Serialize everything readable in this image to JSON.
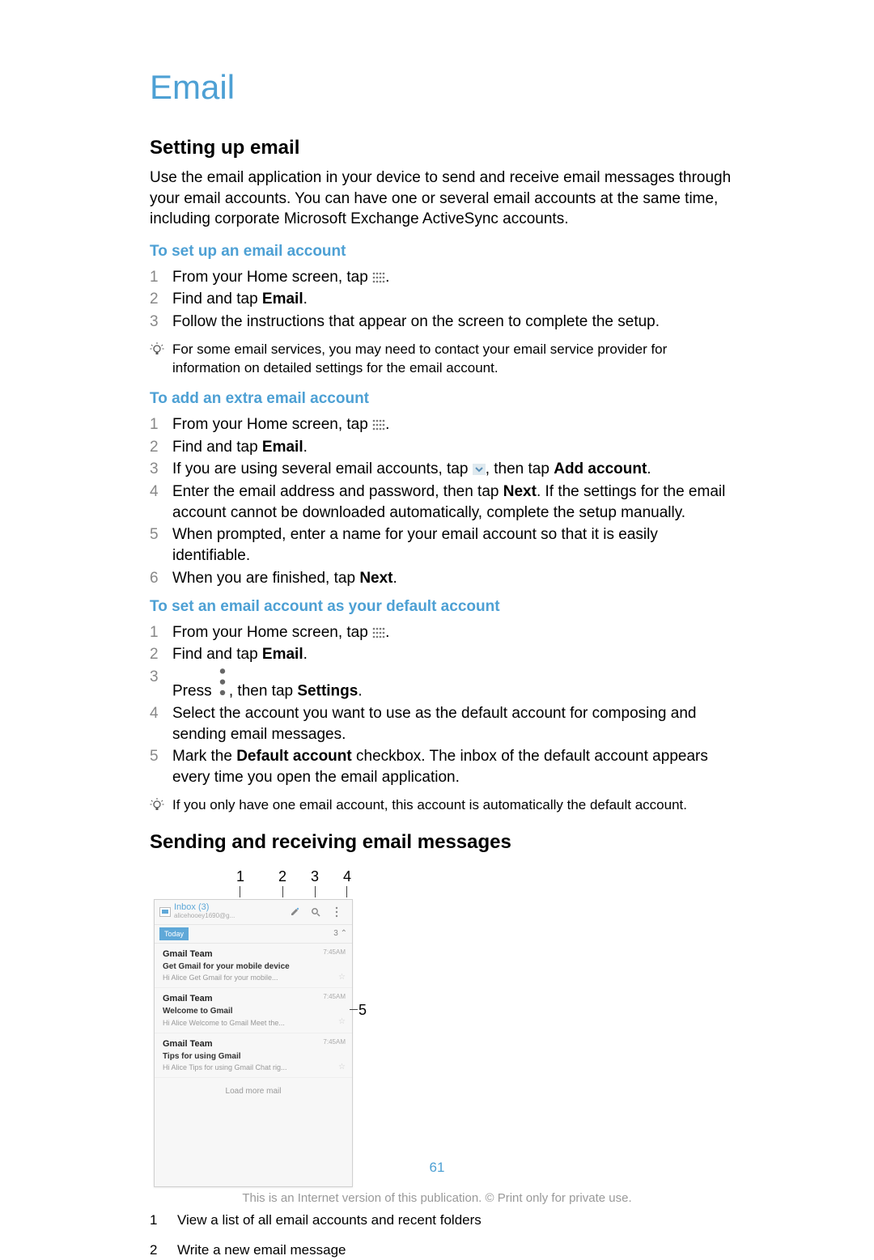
{
  "page": {
    "title": "Email",
    "number": "61",
    "footer": "This is an Internet version of this publication. © Print only for private use."
  },
  "section1": {
    "heading": "Setting up email",
    "intro": "Use the email application in your device to send and receive email messages through your email accounts. You can have one or several email accounts at the same time, including corporate Microsoft Exchange ActiveSync accounts."
  },
  "setup": {
    "heading": "To set up an email account",
    "steps": {
      "n1": "1",
      "t1a": "From your Home screen, tap ",
      "t1b": ".",
      "n2": "2",
      "t2a": "Find and tap ",
      "t2b": "Email",
      "t2c": ".",
      "n3": "3",
      "t3": "Follow the instructions that appear on the screen to complete the setup."
    },
    "tip": "For some email services, you may need to contact your email service provider for information on detailed settings for the email account."
  },
  "add": {
    "heading": "To add an extra email account",
    "steps": {
      "n1": "1",
      "t1a": "From your Home screen, tap ",
      "t1b": ".",
      "n2": "2",
      "t2a": "Find and tap ",
      "t2b": "Email",
      "t2c": ".",
      "n3": "3",
      "t3a": "If you are using several email accounts, tap ",
      "t3b": ", then tap ",
      "t3c": "Add account",
      "t3d": ".",
      "n4": "4",
      "t4a": "Enter the email address and password, then tap ",
      "t4b": "Next",
      "t4c": ". If the settings for the email account cannot be downloaded automatically, complete the setup manually.",
      "n5": "5",
      "t5": "When prompted, enter a name for your email account so that it is easily identifiable.",
      "n6": "6",
      "t6a": "When you are finished, tap ",
      "t6b": "Next",
      "t6c": "."
    }
  },
  "default": {
    "heading": "To set an email account as your default account",
    "steps": {
      "n1": "1",
      "t1a": "From your Home screen, tap ",
      "t1b": ".",
      "n2": "2",
      "t2a": "Find and tap ",
      "t2b": "Email",
      "t2c": ".",
      "n3": "3",
      "t3a": "Press ",
      "t3b": ", then tap ",
      "t3c": "Settings",
      "t3d": ".",
      "n4": "4",
      "t4": "Select the account you want to use as the default account for composing and sending email messages.",
      "n5": "5",
      "t5a": "Mark the ",
      "t5b": "Default account",
      "t5c": " checkbox. The inbox of the default account appears every time you open the email application."
    },
    "tip": "If you only have one email account, this account is automatically the default account."
  },
  "section2": {
    "heading": "Sending and receiving email messages"
  },
  "figure": {
    "labels": {
      "l1": "1",
      "l2": "2",
      "l3": "3",
      "l4": "4",
      "l5": "5"
    },
    "app": {
      "inbox": "Inbox (3)",
      "account": "alicehooey1690@g...",
      "today": "Today",
      "today_count": "3",
      "collapse": "⌃",
      "messages": [
        {
          "sender": "Gmail Team",
          "subject": "Get Gmail for your mobile device",
          "preview": "Hi Alice Get Gmail for your mobile...",
          "time": "7:45AM"
        },
        {
          "sender": "Gmail Team",
          "subject": "Welcome to Gmail",
          "preview": "Hi Alice Welcome to Gmail Meet the...",
          "time": "7:45AM"
        },
        {
          "sender": "Gmail Team",
          "subject": "Tips for using Gmail",
          "preview": "Hi Alice Tips for using Gmail Chat rig...",
          "time": "7:45AM"
        }
      ],
      "loadmore": "Load more mail"
    }
  },
  "legend": {
    "n1": "1",
    "t1": "View a list of all email accounts and recent folders",
    "n2": "2",
    "t2": "Write a new email message"
  }
}
